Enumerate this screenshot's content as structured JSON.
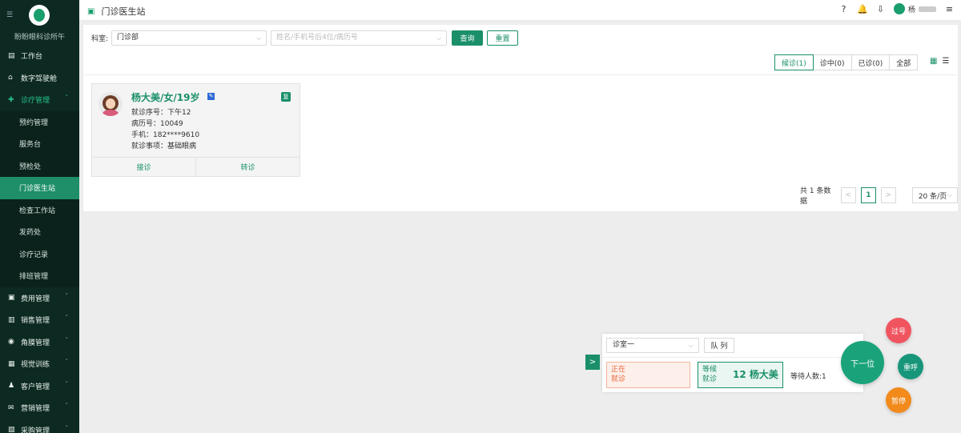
{
  "sidebar": {
    "toggle_icon": "menu-icon",
    "brand": "盼盼眼科诊所午",
    "items": [
      {
        "label": "工作台",
        "icon": "workbench-icon",
        "type": "top"
      },
      {
        "label": "数字驾驶舱",
        "icon": "home-icon",
        "type": "top"
      },
      {
        "label": "诊疗管理",
        "icon": "medical-icon",
        "type": "open",
        "chevron": "˄"
      },
      {
        "label": "预约管理",
        "type": "sub"
      },
      {
        "label": "服务台",
        "type": "sub"
      },
      {
        "label": "预检处",
        "type": "sub"
      },
      {
        "label": "门诊医生站",
        "type": "sub",
        "active": true
      },
      {
        "label": "检查工作站",
        "type": "sub"
      },
      {
        "label": "发药处",
        "type": "sub"
      },
      {
        "label": "诊疗记录",
        "type": "sub"
      },
      {
        "label": "排班管理",
        "type": "sub"
      },
      {
        "label": "费用管理",
        "icon": "fee-icon",
        "type": "top",
        "chevron": "˅"
      },
      {
        "label": "销售管理",
        "icon": "sales-icon",
        "type": "top",
        "chevron": "˅"
      },
      {
        "label": "角膜管理",
        "icon": "eye-icon",
        "type": "top",
        "chevron": "˅"
      },
      {
        "label": "视觉训练",
        "icon": "training-icon",
        "type": "top",
        "chevron": "˅"
      },
      {
        "label": "客户管理",
        "icon": "customer-icon",
        "type": "top",
        "chevron": "˅"
      },
      {
        "label": "营销管理",
        "icon": "marketing-icon",
        "type": "top",
        "chevron": "˅"
      },
      {
        "label": "采购管理",
        "icon": "purchase-icon",
        "type": "top",
        "chevron": "˅"
      }
    ]
  },
  "header": {
    "title": "门诊医生站",
    "title_icon": "clinic-icon",
    "user_name": "杨"
  },
  "filter": {
    "dept_label": "科室:",
    "dept_value": "门诊部",
    "search_placeholder": "姓名/手机号后4位/病历号",
    "query_label": "查询",
    "reset_label": "重置"
  },
  "tabs": [
    {
      "label": "候诊(1)",
      "active": true
    },
    {
      "label": "诊中(0)"
    },
    {
      "label": "已诊(0)"
    },
    {
      "label": "全部"
    }
  ],
  "patient": {
    "name": "杨大美/女/19岁",
    "followup_badge": "复",
    "visit_no": "就诊序号：下午12",
    "record_no": "病历号：10049",
    "phone": "手机：182****9610",
    "purpose": "就诊事项：基础眼病",
    "accept_label": "接诊",
    "transfer_label": "转诊"
  },
  "pagination": {
    "total": "共 1 条数据",
    "prev": "<",
    "current": "1",
    "next": ">",
    "page_size": "20 条/页"
  },
  "call_widget": {
    "expand": ">",
    "room": "诊室一",
    "queue_label": "队 列",
    "current_label_1": "正在",
    "current_label_2": "就诊",
    "waiting_label_1": "等候",
    "waiting_label_2": "就诊",
    "waiting_name": "12 杨大美",
    "waiting_count": "等待人数:1",
    "next_label": "下一位",
    "skip_label": "过号",
    "recall_label": "重呼",
    "pause_label": "暂停"
  },
  "colors": {
    "sidebar_bg": "#0d2a22",
    "accent": "#1a8f6a",
    "danger": "#f0555f",
    "warning": "#f28a1c"
  }
}
